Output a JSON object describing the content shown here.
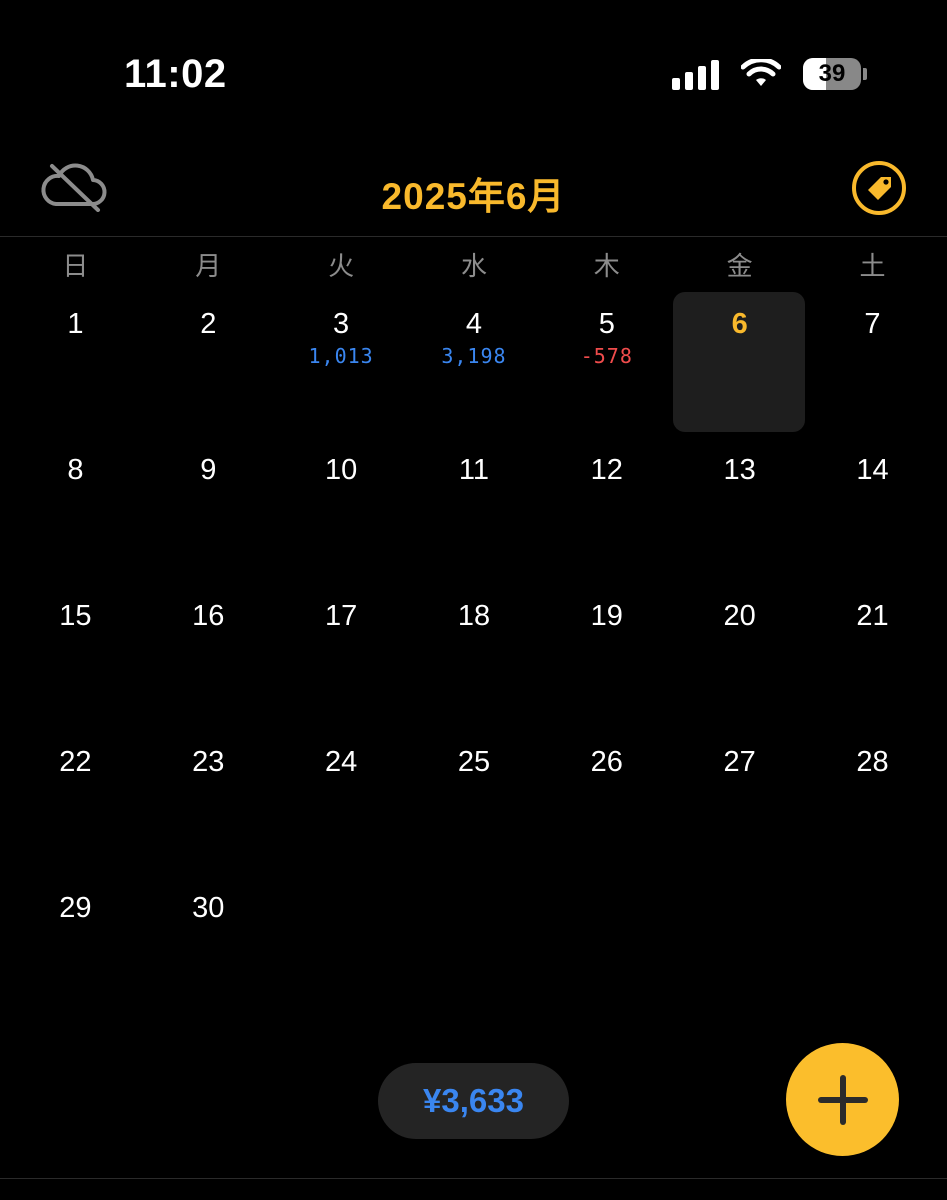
{
  "status_bar": {
    "time": "11:02",
    "battery_level": 39,
    "battery_text": "39",
    "icons": [
      "cellular-signal-icon",
      "wifi-icon",
      "battery-icon"
    ]
  },
  "header": {
    "title": "2025年6月",
    "left_icon": "cloud-off-icon",
    "right_icon": "tag-icon",
    "accent_color": "#f9b92c"
  },
  "weekdays": [
    "日",
    "月",
    "火",
    "水",
    "木",
    "金",
    "土"
  ],
  "calendar": {
    "year": 2025,
    "month": 6,
    "first_weekday_index": 0,
    "today": 6,
    "days": [
      {
        "day": "1",
        "amount": ""
      },
      {
        "day": "2",
        "amount": ""
      },
      {
        "day": "3",
        "amount": "1,013",
        "type": "positive"
      },
      {
        "day": "4",
        "amount": "3,198",
        "type": "positive"
      },
      {
        "day": "5",
        "amount": "-578",
        "type": "negative"
      },
      {
        "day": "6",
        "amount": "",
        "today": true
      },
      {
        "day": "7",
        "amount": ""
      },
      {
        "day": "8",
        "amount": ""
      },
      {
        "day": "9",
        "amount": ""
      },
      {
        "day": "10",
        "amount": ""
      },
      {
        "day": "11",
        "amount": ""
      },
      {
        "day": "12",
        "amount": ""
      },
      {
        "day": "13",
        "amount": ""
      },
      {
        "day": "14",
        "amount": ""
      },
      {
        "day": "15",
        "amount": ""
      },
      {
        "day": "16",
        "amount": ""
      },
      {
        "day": "17",
        "amount": ""
      },
      {
        "day": "18",
        "amount": ""
      },
      {
        "day": "19",
        "amount": ""
      },
      {
        "day": "20",
        "amount": ""
      },
      {
        "day": "21",
        "amount": ""
      },
      {
        "day": "22",
        "amount": ""
      },
      {
        "day": "23",
        "amount": ""
      },
      {
        "day": "24",
        "amount": ""
      },
      {
        "day": "25",
        "amount": ""
      },
      {
        "day": "26",
        "amount": ""
      },
      {
        "day": "27",
        "amount": ""
      },
      {
        "day": "28",
        "amount": ""
      },
      {
        "day": "29",
        "amount": ""
      },
      {
        "day": "30",
        "amount": ""
      }
    ]
  },
  "total": {
    "label": "¥3,633",
    "color": "#3a86f0"
  },
  "add_button": {
    "icon": "plus-icon",
    "color": "#fbbe2c"
  },
  "colors": {
    "positive": "#3a86f0",
    "negative": "#f04c4c",
    "today_bg": "#1e1e1e"
  }
}
